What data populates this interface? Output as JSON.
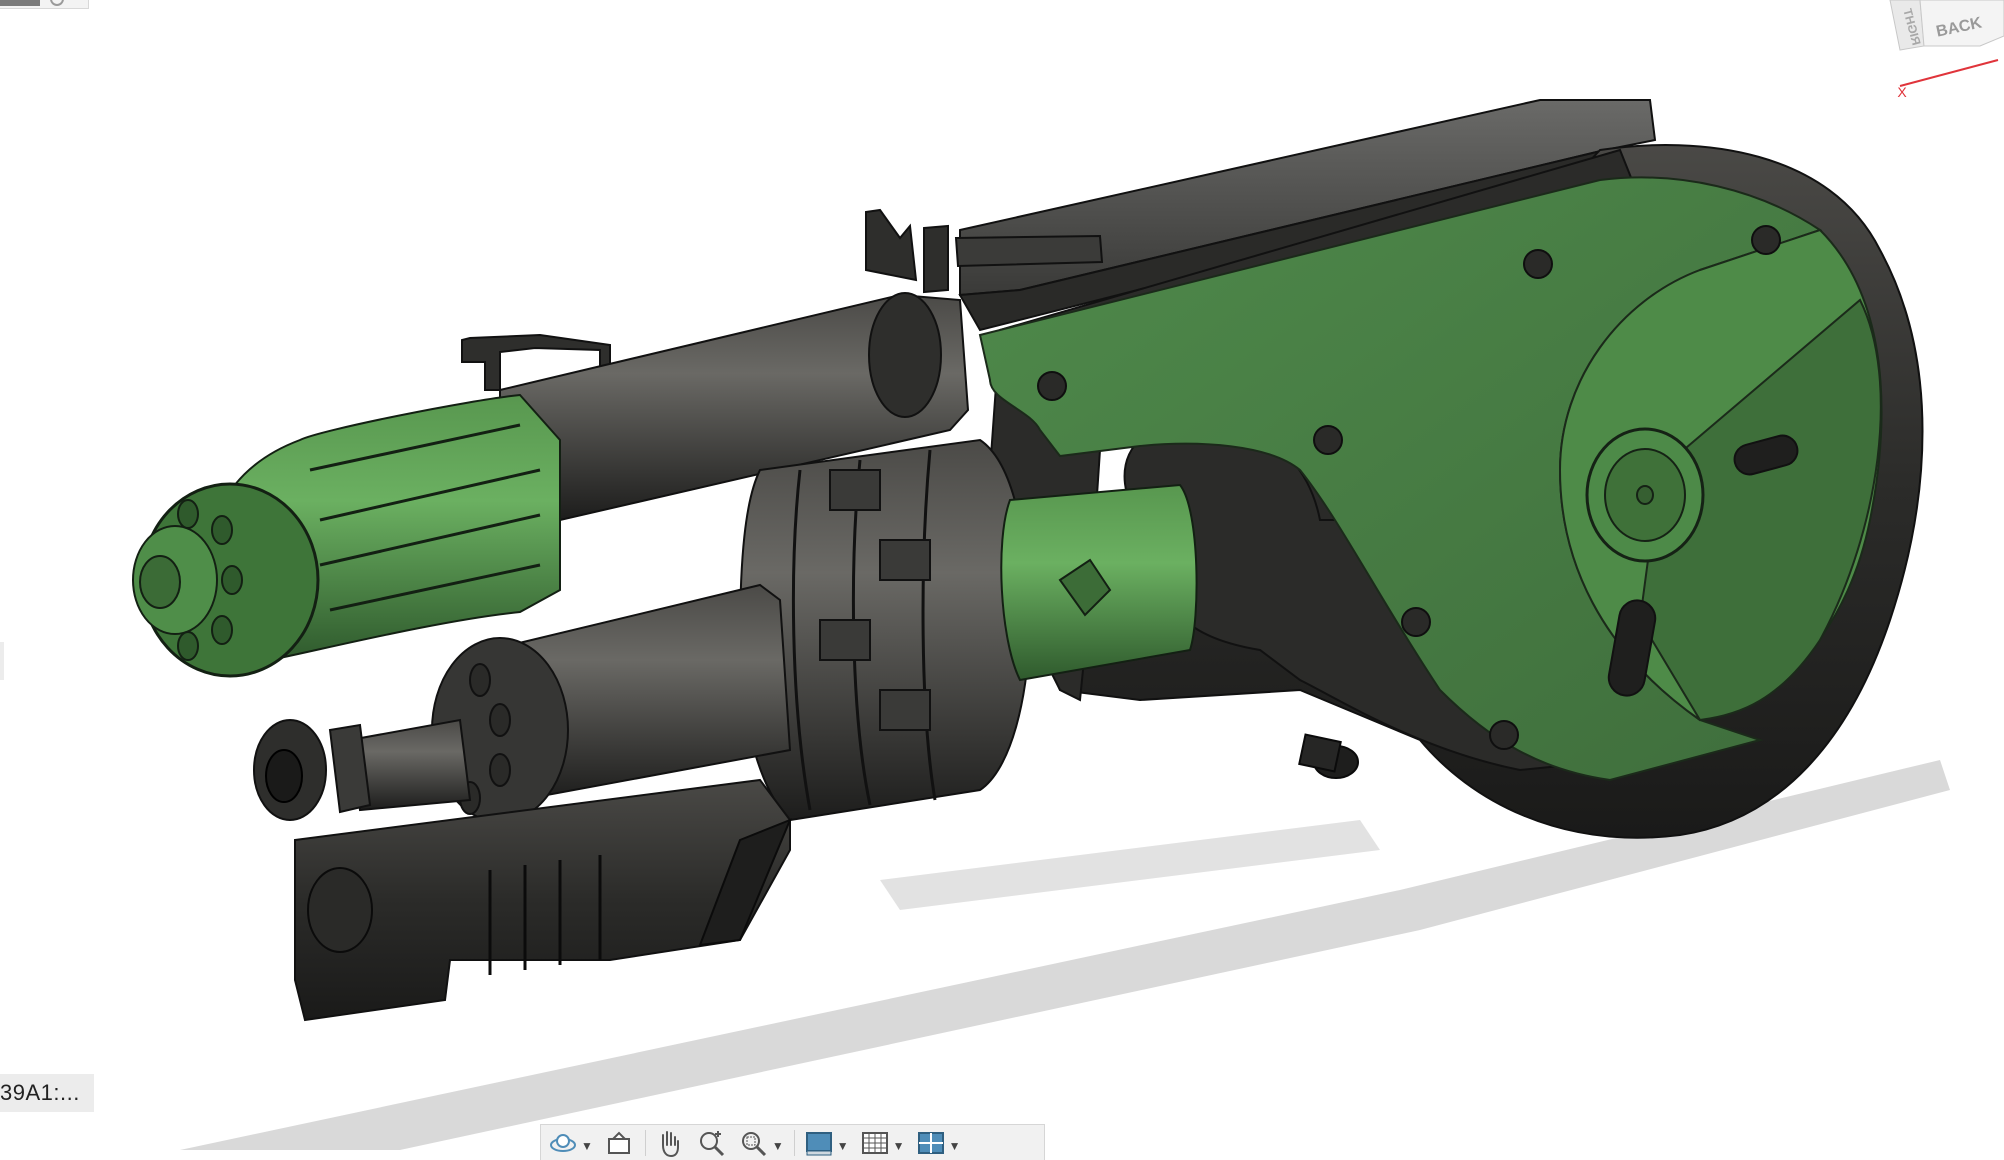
{
  "window": {
    "browser_label": "39A1:..."
  },
  "viewcube": {
    "faces": {
      "front": "BACK",
      "side": "RIGHT"
    },
    "axis_label": "X",
    "axis_color": "#e0343b"
  },
  "model": {
    "primary_color": "#4a7a46",
    "body_color": "#2e2e2c",
    "shadow_color": "#d6d6d6"
  },
  "navigation_bar": {
    "tools": [
      {
        "icon": "orbit-icon",
        "has_dropdown": true
      },
      {
        "icon": "look-at-icon",
        "has_dropdown": false
      },
      {
        "icon": "pan-hand-icon",
        "has_dropdown": false
      },
      {
        "icon": "zoom-icon",
        "has_dropdown": false
      },
      {
        "icon": "zoom-window-icon",
        "has_dropdown": true
      },
      {
        "icon": "display-settings-icon",
        "has_dropdown": true
      },
      {
        "icon": "grid-icon",
        "has_dropdown": true
      },
      {
        "icon": "viewports-icon",
        "has_dropdown": true
      }
    ]
  }
}
